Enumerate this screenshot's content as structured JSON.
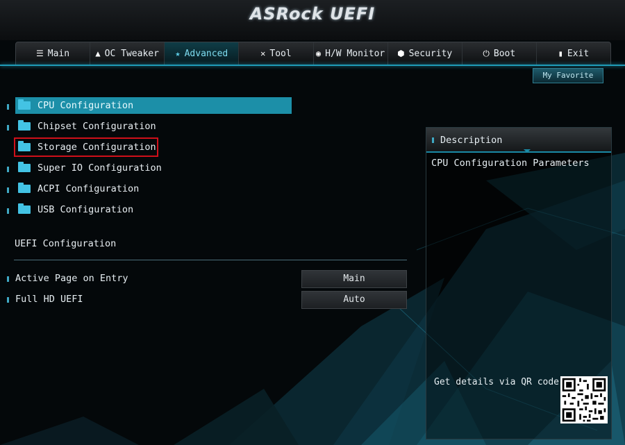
{
  "app": {
    "logo_text": "ASRock UEFI"
  },
  "tabs": [
    {
      "label": "Main",
      "icon": "list-icon",
      "active": false
    },
    {
      "label": "OC Tweaker",
      "icon": "rocket-icon",
      "active": false
    },
    {
      "label": "Advanced",
      "icon": "star-icon",
      "active": true
    },
    {
      "label": "Tool",
      "icon": "wrench-icon",
      "active": false
    },
    {
      "label": "H/W Monitor",
      "icon": "monitor-icon",
      "active": false
    },
    {
      "label": "Security",
      "icon": "shield-icon",
      "active": false
    },
    {
      "label": "Boot",
      "icon": "power-icon",
      "active": false
    },
    {
      "label": "Exit",
      "icon": "exit-icon",
      "active": false
    }
  ],
  "favorite": {
    "label": "My Favorite"
  },
  "menu": {
    "items": [
      {
        "label": "CPU Configuration"
      },
      {
        "label": "Chipset Configuration"
      },
      {
        "label": "Storage Configuration"
      },
      {
        "label": "Super IO Configuration"
      },
      {
        "label": "ACPI Configuration"
      },
      {
        "label": "USB Configuration"
      }
    ]
  },
  "uefi_section": {
    "title": "UEFI Configuration",
    "settings": [
      {
        "label": "Active Page on Entry",
        "value": "Main"
      },
      {
        "label": "Full HD UEFI",
        "value": "Auto"
      }
    ]
  },
  "description": {
    "title": "Description",
    "text": "CPU Configuration Parameters",
    "qr_text": "Get details via QR code"
  },
  "colors": {
    "accent": "#1c8fa8",
    "highlight_box": "#d0101a",
    "folder": "#43c3e4"
  }
}
